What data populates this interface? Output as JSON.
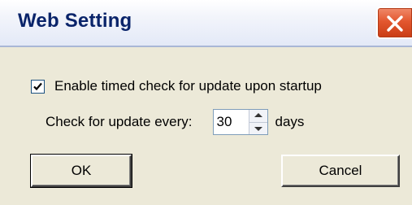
{
  "window": {
    "title": "Web Setting",
    "close_icon": "close-x-icon"
  },
  "options": {
    "enable_check_label": "Enable timed check for update upon startup",
    "enable_check_checked": true,
    "interval_label": "Check for update every:",
    "interval_value": "30",
    "interval_unit": "days"
  },
  "buttons": {
    "ok_label": "OK",
    "cancel_label": "Cancel"
  },
  "colors": {
    "title_text": "#0a246a",
    "close_button": "#e3572f",
    "dialog_background": "#ece9d8"
  }
}
